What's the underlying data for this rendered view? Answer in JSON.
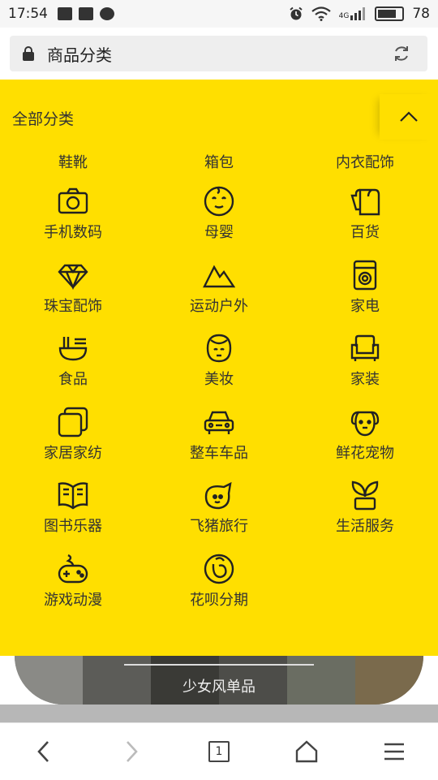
{
  "status_bar": {
    "time": "17:54",
    "network": "4G",
    "battery": "78"
  },
  "address_bar": {
    "title": "商品分类"
  },
  "panel": {
    "title": "全部分类",
    "top_categories": [
      "鞋靴",
      "箱包",
      "内衣配饰"
    ],
    "categories": [
      {
        "label": "手机数码",
        "icon": "camera-icon"
      },
      {
        "label": "母婴",
        "icon": "baby-face-icon"
      },
      {
        "label": "百货",
        "icon": "tissue-roll-icon"
      },
      {
        "label": "珠宝配饰",
        "icon": "diamond-icon"
      },
      {
        "label": "运动户外",
        "icon": "mountain-icon"
      },
      {
        "label": "家电",
        "icon": "washing-machine-icon"
      },
      {
        "label": "食品",
        "icon": "noodle-bowl-icon"
      },
      {
        "label": "美妆",
        "icon": "girl-face-icon"
      },
      {
        "label": "家装",
        "icon": "sofa-icon"
      },
      {
        "label": "家居家纺",
        "icon": "pillow-icon"
      },
      {
        "label": "整车车品",
        "icon": "car-icon"
      },
      {
        "label": "鲜花宠物",
        "icon": "dog-icon"
      },
      {
        "label": "图书乐器",
        "icon": "book-icon"
      },
      {
        "label": "飞猪旅行",
        "icon": "fliggy-icon"
      },
      {
        "label": "生活服务",
        "icon": "sprout-icon"
      },
      {
        "label": "游戏动漫",
        "icon": "gamepad-icon"
      },
      {
        "label": "花呗分期",
        "icon": "huabei-icon"
      }
    ]
  },
  "banner": {
    "label": "少女风单品"
  },
  "toolbar": {
    "tab_count": "1"
  }
}
